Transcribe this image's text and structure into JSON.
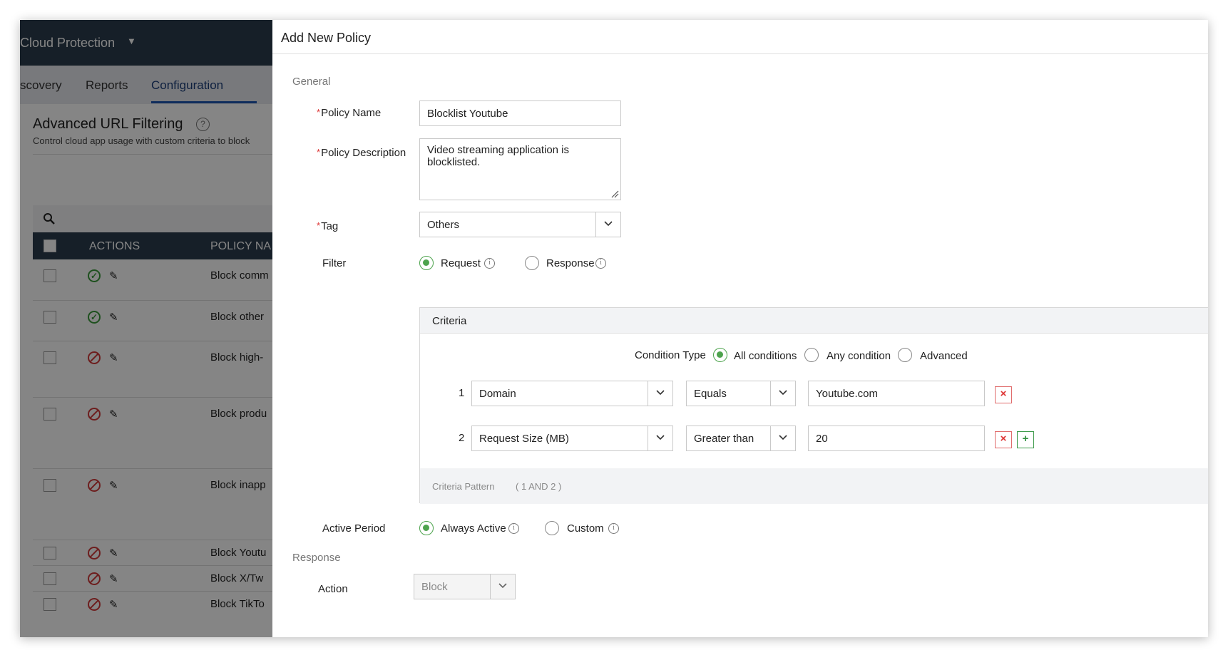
{
  "background": {
    "app_name": "Cloud Protection",
    "tabs": [
      "scovery",
      "Reports",
      "Configuration"
    ],
    "active_tab": "Configuration",
    "page_title": "Advanced URL Filtering",
    "page_description": "Control cloud app usage with custom criteria to block",
    "table": {
      "headers": [
        "ACTIONS",
        "POLICY NA"
      ],
      "rows": [
        {
          "status": "enabled",
          "name": "Block comm"
        },
        {
          "status": "enabled",
          "name": "Block other"
        },
        {
          "status": "disabled",
          "name": "Block high-"
        },
        {
          "status": "disabled",
          "name": "Block produ"
        },
        {
          "status": "disabled",
          "name": "Block inapp"
        },
        {
          "status": "disabled",
          "name": "Block Youtu"
        },
        {
          "status": "disabled",
          "name": "Block X/Tw"
        },
        {
          "status": "disabled",
          "name": "Block TikTo"
        }
      ]
    }
  },
  "panel": {
    "title": "Add New Policy",
    "general_label": "General",
    "policy_name_label": "Policy Name",
    "policy_name_value": "Blocklist Youtube",
    "policy_description_label": "Policy Description",
    "policy_description_value": "Video streaming application is blocklisted.",
    "tag_label": "Tag",
    "tag_value": "Others",
    "filter_label": "Filter",
    "filter_options": [
      "Request",
      "Response"
    ],
    "filter_selected": "Request",
    "criteria": {
      "title": "Criteria",
      "condition_type_label": "Condition Type",
      "condition_options": [
        "All conditions",
        "Any condition",
        "Advanced"
      ],
      "condition_selected": "All conditions",
      "rows": [
        {
          "index": "1",
          "field": "Domain",
          "operator": "Equals",
          "value": "Youtube.com"
        },
        {
          "index": "2",
          "field": "Request Size (MB)",
          "operator": "Greater than",
          "value": "20"
        }
      ],
      "pattern_label": "Criteria Pattern",
      "pattern_value": "( 1 AND 2 )"
    },
    "active_period_label": "Active Period",
    "active_period_options": [
      "Always Active",
      "Custom"
    ],
    "active_period_selected": "Always Active",
    "response_label": "Response",
    "action_label": "Action",
    "action_value": "Block"
  },
  "colors": {
    "accent_green": "#4da34d",
    "header_dark": "#2b3d4d",
    "remove_red": "#d33333",
    "add_green": "#2f8f3d"
  }
}
